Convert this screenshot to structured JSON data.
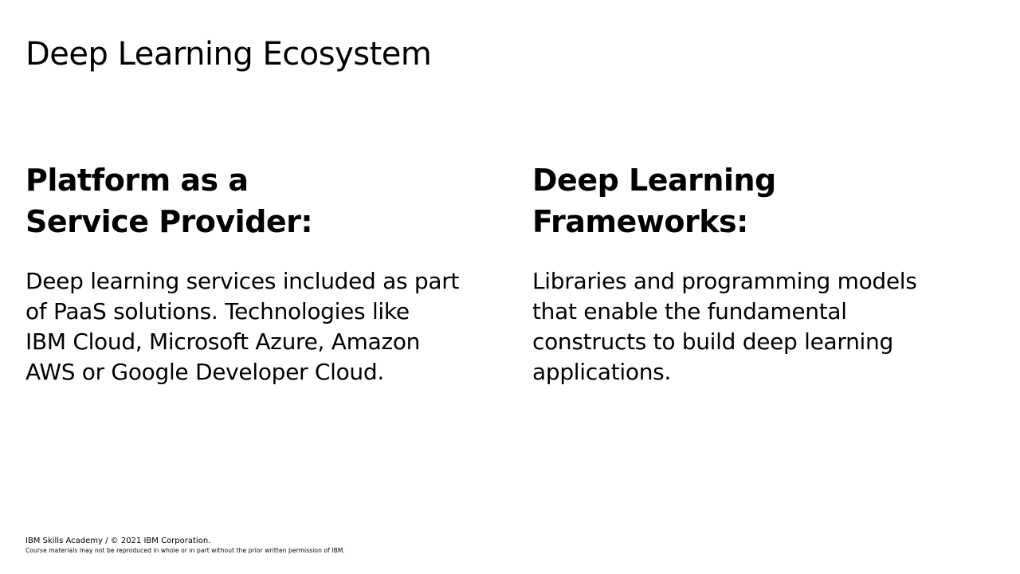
{
  "slide": {
    "title": "Deep Learning Ecosystem",
    "columns": [
      {
        "heading_lines": [
          "Platform as a",
          "Service Provider:"
        ],
        "body_lines": [
          "Deep learning services included as part",
          "of PaaS solutions. Technologies like",
          "IBM Cloud, Microsoft Azure, Amazon",
          "AWS or Google Developer Cloud."
        ]
      },
      {
        "heading_lines": [
          "Deep Learning",
          "Frameworks:"
        ],
        "body_lines": [
          "Libraries and programming models",
          "that enable the fundamental",
          "constructs to build deep learning",
          "applications."
        ]
      }
    ]
  },
  "footer": {
    "copyright": "IBM Skills Academy / © 2021 IBM Corporation.",
    "notice": "Course materials may not be reproduced  in whole or in part without the prior written permission  of IBM."
  }
}
